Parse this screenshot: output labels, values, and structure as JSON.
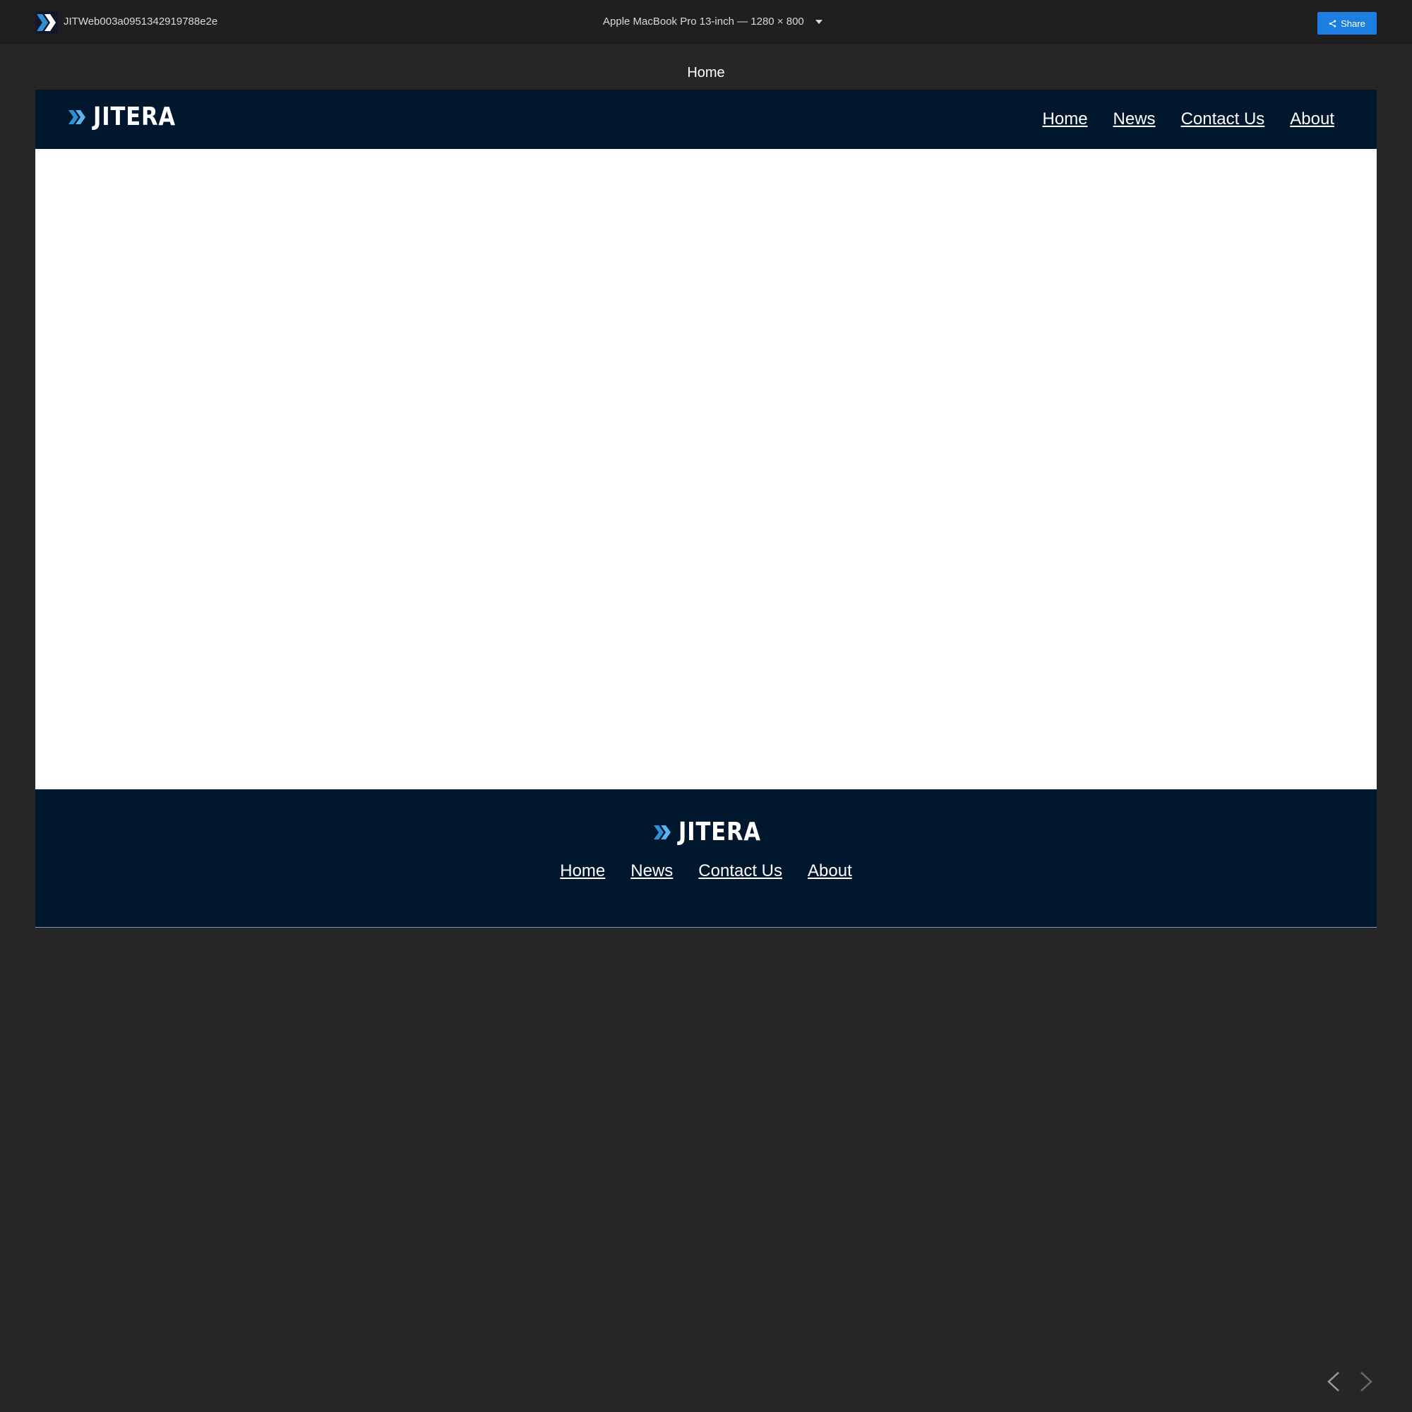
{
  "topbar": {
    "project_name": "JITWeb003a0951342919788e2e",
    "device": "Apple MacBook Pro 13-inch — 1280 × 800",
    "share_label": "Share",
    "share_color": "#1b7ee0"
  },
  "screen_title": "Home",
  "site": {
    "brand": "JITERA",
    "brand_colors": {
      "navy": "#00172d",
      "accent": "#2e8fd6"
    },
    "nav": [
      "Home",
      "News",
      "Contact Us",
      "About"
    ],
    "footer_nav": [
      "Home",
      "News",
      "Contact Us",
      "About"
    ]
  },
  "icons": {
    "app": "jitera-chevrons-icon",
    "share": "share-icon",
    "caret": "chevron-down-icon",
    "prev": "chevron-left-icon",
    "next": "chevron-right-icon"
  }
}
